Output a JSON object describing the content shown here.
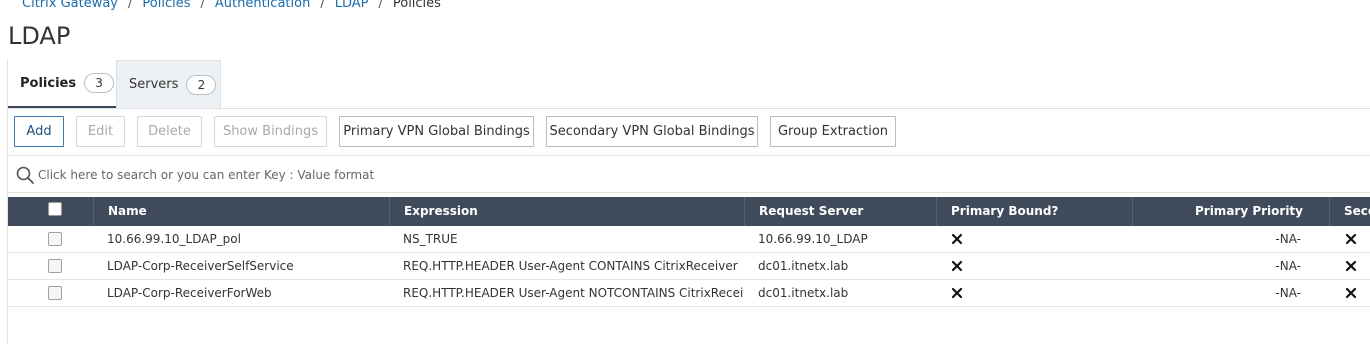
{
  "breadcrumb": {
    "items": [
      "Citrix Gateway",
      "Policies",
      "Authentication",
      "LDAP"
    ],
    "current": "Policies",
    "separator": "/"
  },
  "page_title": "LDAP",
  "tabs": [
    {
      "label": "Policies",
      "count": "3",
      "active": true
    },
    {
      "label": "Servers",
      "count": "2",
      "active": false
    }
  ],
  "toolbar": {
    "add": "Add",
    "edit": "Edit",
    "delete": "Delete",
    "show_bindings": "Show Bindings",
    "primary_vpn": "Primary VPN Global Bindings",
    "secondary_vpn": "Secondary VPN Global Bindings",
    "group_extraction": "Group Extraction"
  },
  "search": {
    "placeholder": "Click here to search or you can enter Key : Value format"
  },
  "table": {
    "columns": [
      "Name",
      "Expression",
      "Request Server",
      "Primary Bound?",
      "Primary Priority",
      "Seco"
    ],
    "rows": [
      {
        "name": "10.66.99.10_LDAP_pol",
        "expression": "NS_TRUE",
        "server": "10.66.99.10_LDAP",
        "primary_bound": "x-icon",
        "primary_priority": "-NA-",
        "secondary_bound": "x-icon"
      },
      {
        "name": "LDAP-Corp-ReceiverSelfService",
        "expression": "REQ.HTTP.HEADER User-Agent CONTAINS CitrixReceiver",
        "server": "dc01.itnetx.lab",
        "primary_bound": "x-icon",
        "primary_priority": "-NA-",
        "secondary_bound": "x-icon"
      },
      {
        "name": "LDAP-Corp-ReceiverForWeb",
        "expression": "REQ.HTTP.HEADER User-Agent NOTCONTAINS CitrixReceiver",
        "server": "dc01.itnetx.lab",
        "primary_bound": "x-icon",
        "primary_priority": "-NA-",
        "secondary_bound": "x-icon"
      }
    ]
  },
  "colors": {
    "link": "#1a6cab",
    "header_bg": "#3f4a5a",
    "accent": "#3a78b8"
  }
}
